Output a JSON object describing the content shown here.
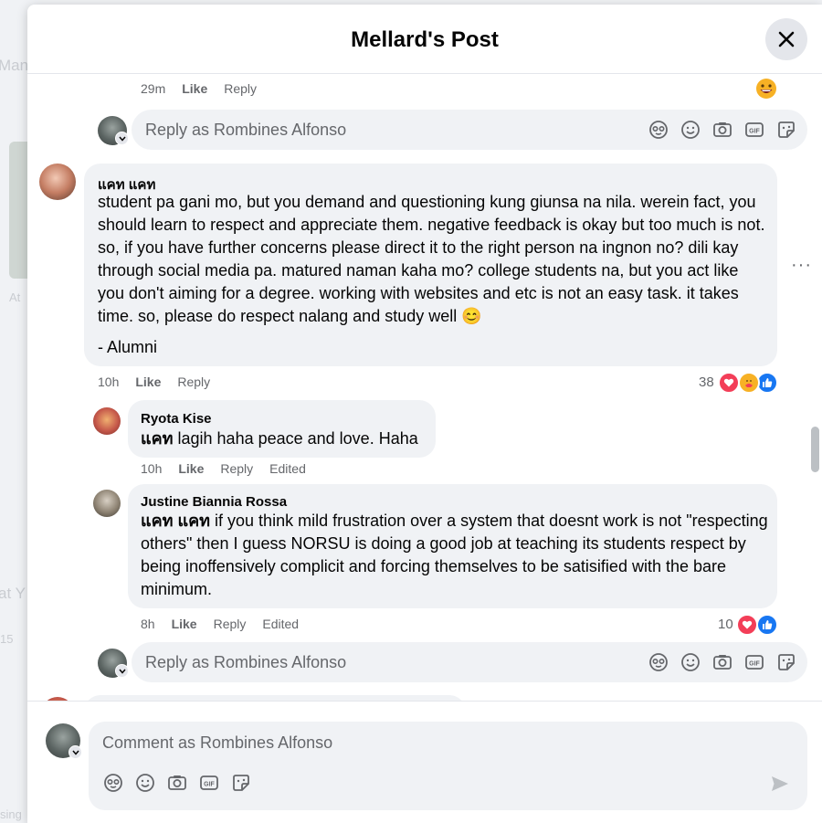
{
  "background": {
    "ghost_text": [
      "Man",
      "At",
      "at Y",
      "15",
      "sing"
    ]
  },
  "modal": {
    "title": "Mellard's Post",
    "close_icon": "close-icon"
  },
  "top_meta": {
    "time": "29m",
    "like": "Like",
    "reply": "Reply",
    "reaction_icon": "grin-emoji"
  },
  "reply_box_1": {
    "placeholder": "Reply as Rombines Alfonso"
  },
  "comment_main": {
    "author": "แคท แคท",
    "text": "student pa gani mo, but you demand and questioning kung giunsa na nila. werein fact, you should learn to respect and appreciate them. negative feedback is okay but too much is not. so, if you have further concerns please direct it to the right person na ingnon no? dili kay through social media pa. matured naman kaha mo? college students na, but you act like you don't aiming for a degree. working with websites and etc is not an easy task. it takes time. so, please do respect nalang and study well 😊",
    "signature": "- Alumni",
    "time": "10h",
    "like": "Like",
    "reply": "Reply",
    "reaction_count": "38",
    "more": "···"
  },
  "reply_ryota": {
    "author": "Ryota Kise",
    "tag": "แคท",
    "text": " lagih haha peace and love. Haha",
    "time": "10h",
    "like": "Like",
    "reply": "Reply",
    "edited": "Edited"
  },
  "reply_justine": {
    "author": "Justine Biannia Rossa",
    "tag": "แคท แคท",
    "text": " if you think mild frustration over a system that doesnt work is not \"respecting others\" then I guess NORSU is doing a good job at teaching its students respect by being inoffensively complicit and forcing themselves to be satisified with the bare minimum.",
    "time": "8h",
    "like": "Like",
    "reply": "Reply",
    "edited": "Edited",
    "reaction_count": "10"
  },
  "reply_box_2": {
    "placeholder": "Reply as Rombines Alfonso"
  },
  "footer": {
    "placeholder": "Comment as Rombines Alfonso"
  },
  "colors": {
    "like_blue": "#1877f2",
    "love_red": "#f33e58",
    "care_yellow": "#f7b125"
  }
}
